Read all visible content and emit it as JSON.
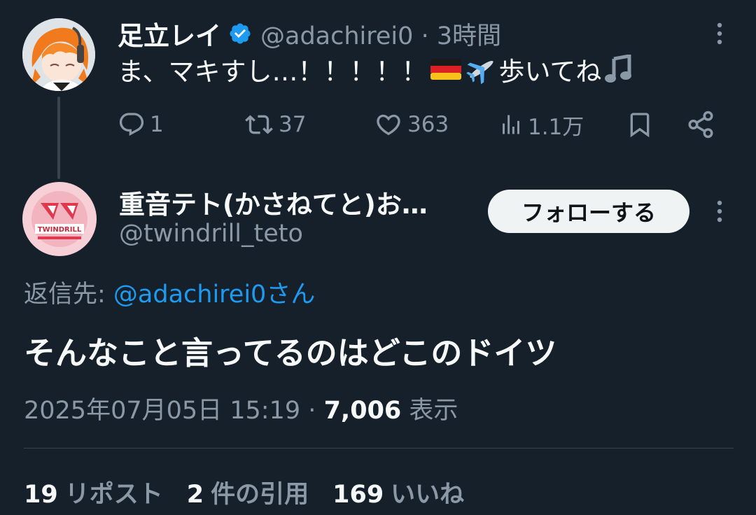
{
  "parent_tweet": {
    "display_name": "足立レイ",
    "handle": "@adachirei0",
    "separator": "·",
    "time": "3時間",
    "text_before_emoji": "ま、マキすし…！！！！！",
    "text_after_emoji": "歩いてね",
    "emojis": [
      "germany-flag",
      "airplane",
      "musical-note"
    ],
    "actions": {
      "replies": "1",
      "reposts": "37",
      "likes": "363",
      "views": "1.1万"
    }
  },
  "reply_tweet": {
    "display_name": "重音テト(かさねてと)お…",
    "handle": "@twindrill_teto",
    "follow_label": "フォローする",
    "reply_to_prefix": "返信先: ",
    "reply_to_mention": "@adachirei0さん",
    "text": "そんなこと言ってるのはどこのドイツ",
    "timestamp": "2025年07月05日 15:19",
    "separator": "·",
    "views_count": "7,006",
    "views_label": "表示",
    "stats": {
      "reposts_count": "19",
      "reposts_label": "リポスト",
      "quotes_count": "2",
      "quotes_label": "件の引用",
      "likes_count": "169",
      "likes_label": "いいね"
    },
    "avatar_text": "TWINDRILL"
  },
  "colors": {
    "background": "#15202b",
    "primary_text": "#f7f9f9",
    "secondary_text": "#8b98a5",
    "accent": "#1d9bf0",
    "divider": "#38444d"
  }
}
